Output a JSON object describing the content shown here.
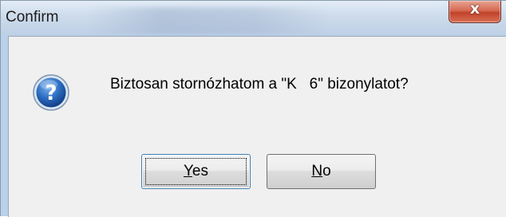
{
  "window": {
    "title": "Confirm",
    "close_icon": "close-icon",
    "close_glyph": "x"
  },
  "dialog": {
    "icon": "question-icon",
    "message": "Biztosan stornózhatom a \"K   6\" bizonylatot?"
  },
  "buttons": {
    "yes": {
      "mnemonic": "Y",
      "rest": "es",
      "focused": true
    },
    "no": {
      "mnemonic": "N",
      "rest": "o",
      "focused": false
    }
  },
  "colors": {
    "client_bg": "#f0f0f0",
    "titlebar": "#cfdcec",
    "close_button": "#c9503a",
    "icon_blue": "#2a62b8"
  }
}
